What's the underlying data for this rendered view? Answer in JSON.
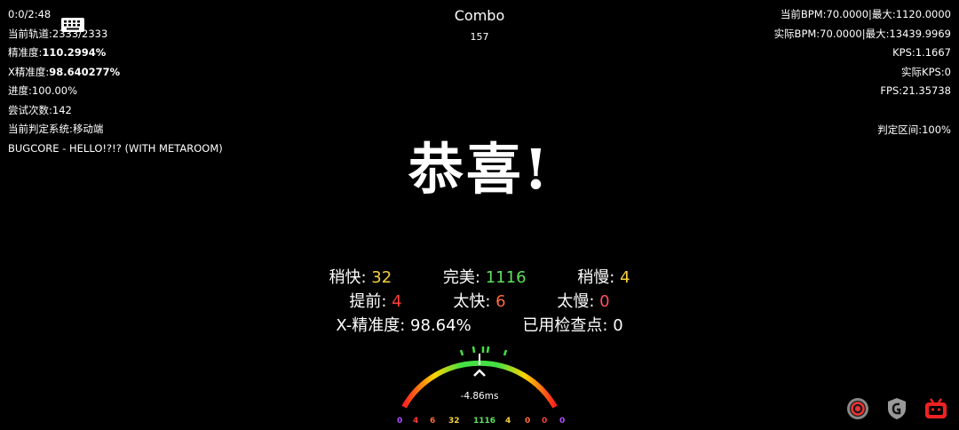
{
  "hud_left": {
    "time": "0:0/2:48",
    "track": "当前轨道:",
    "track_value": "2333/2333",
    "accuracy": "精准度:",
    "accuracy_value": "110.2994%",
    "x_accuracy": "X精准度:",
    "x_accuracy_value": "98.640277%",
    "progress": "进度:100.00%",
    "attempts": "尝试次数:142",
    "judge_system": "当前判定系统:移动端",
    "song": "BUGCORE - HELLO!?!? (WITH METAROOM)"
  },
  "hud_right": {
    "bpm": "当前BPM:70.0000|最大:1120.0000",
    "real_bpm": "实际BPM:70.0000|最大:13439.9969",
    "kps": "KPS:1.1667",
    "real_kps": "实际KPS:0",
    "fps": "FPS:21.35738",
    "judge_range": "判定区间:100%"
  },
  "combo": {
    "label": "Combo",
    "value": "157"
  },
  "congrats": "恭喜!",
  "stats": {
    "slightly_early": {
      "label": "稍快:",
      "value": "32"
    },
    "perfect": {
      "label": "完美:",
      "value": "1116"
    },
    "slightly_late": {
      "label": "稍慢:",
      "value": "4"
    },
    "early": {
      "label": "提前:",
      "value": "4"
    },
    "too_early": {
      "label": "太快:",
      "value": "6"
    },
    "too_late": {
      "label": "太慢:",
      "value": "0"
    },
    "x_accuracy": {
      "label": "X-精准度:",
      "value": "98.64%"
    },
    "checkpoints": {
      "label": "已用检查点:",
      "value": "0"
    }
  },
  "timing_meter": {
    "offset": "-4.86ms",
    "counts": [
      "0",
      "4",
      "6",
      "32",
      "1116",
      "4",
      "0",
      "0",
      "0"
    ]
  },
  "icons": [
    "keyboard-icon",
    "target-icon",
    "shield-icon",
    "bilibili-icon"
  ],
  "colors": {
    "yellow": "#f4d03f",
    "green": "#5ee05e",
    "red": "#ff3b3b",
    "orange": "#ff6a3d",
    "purple": "#b04cff"
  }
}
